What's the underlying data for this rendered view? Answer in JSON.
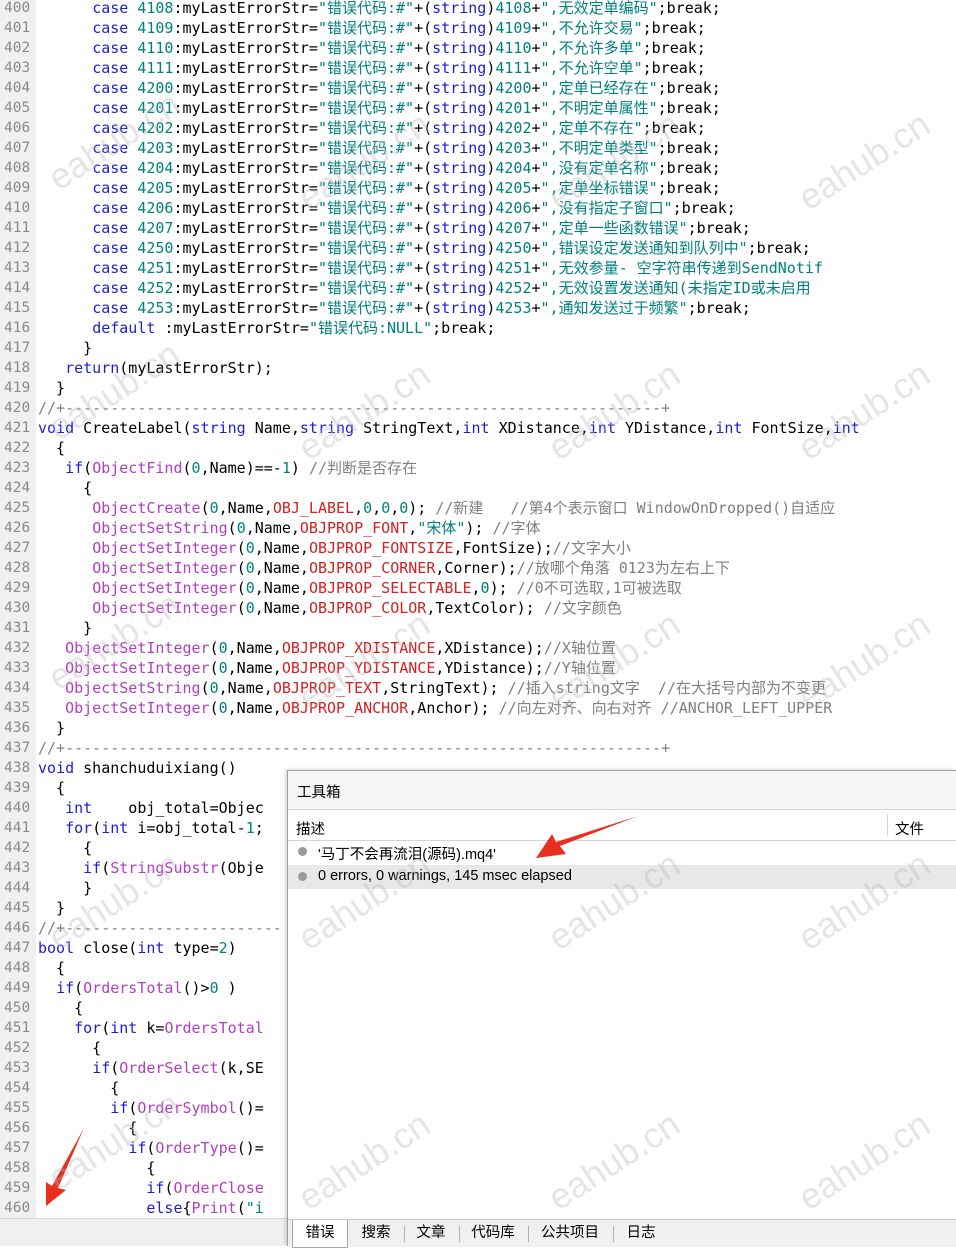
{
  "editor": {
    "lines": [
      {
        "n": "400",
        "t": "      case 4108:myLastErrorStr=\"错误代码:#\"+(string)4108+\",无效定单编码\";break;"
      },
      {
        "n": "401",
        "t": "      case 4109:myLastErrorStr=\"错误代码:#\"+(string)4109+\",不允许交易\";break;"
      },
      {
        "n": "402",
        "t": "      case 4110:myLastErrorStr=\"错误代码:#\"+(string)4110+\",不允许多单\";break;"
      },
      {
        "n": "403",
        "t": "      case 4111:myLastErrorStr=\"错误代码:#\"+(string)4111+\",不允许空单\";break;"
      },
      {
        "n": "404",
        "t": "      case 4200:myLastErrorStr=\"错误代码:#\"+(string)4200+\",定单已经存在\";break;"
      },
      {
        "n": "405",
        "t": "      case 4201:myLastErrorStr=\"错误代码:#\"+(string)4201+\",不明定单属性\";break;"
      },
      {
        "n": "406",
        "t": "      case 4202:myLastErrorStr=\"错误代码:#\"+(string)4202+\",定单不存在\";break;"
      },
      {
        "n": "407",
        "t": "      case 4203:myLastErrorStr=\"错误代码:#\"+(string)4203+\",不明定单类型\";break;"
      },
      {
        "n": "408",
        "t": "      case 4204:myLastErrorStr=\"错误代码:#\"+(string)4204+\",没有定单名称\";break;"
      },
      {
        "n": "409",
        "t": "      case 4205:myLastErrorStr=\"错误代码:#\"+(string)4205+\",定单坐标错误\";break;"
      },
      {
        "n": "410",
        "t": "      case 4206:myLastErrorStr=\"错误代码:#\"+(string)4206+\",没有指定子窗口\";break;"
      },
      {
        "n": "411",
        "t": "      case 4207:myLastErrorStr=\"错误代码:#\"+(string)4207+\",定单一些函数错误\";break;"
      },
      {
        "n": "412",
        "t": "      case 4250:myLastErrorStr=\"错误代码:#\"+(string)4250+\",错误设定发送通知到队列中\";break;"
      },
      {
        "n": "413",
        "t": "      case 4251:myLastErrorStr=\"错误代码:#\"+(string)4251+\",无效参量- 空字符串传递到SendNotif"
      },
      {
        "n": "414",
        "t": "      case 4252:myLastErrorStr=\"错误代码:#\"+(string)4252+\",无效设置发送通知(未指定ID或未启用"
      },
      {
        "n": "415",
        "t": "      case 4253:myLastErrorStr=\"错误代码:#\"+(string)4253+\",通知发送过于频繁\";break;"
      },
      {
        "n": "416",
        "t": "      default :myLastErrorStr=\"错误代码:NULL\";break;"
      },
      {
        "n": "417",
        "t": "     }"
      },
      {
        "n": "418",
        "t": "   return(myLastErrorStr);"
      },
      {
        "n": "419",
        "t": "  }"
      },
      {
        "n": "420",
        "t": "//+------------------------------------------------------------------+"
      },
      {
        "n": "421",
        "t": "void CreateLabel(string Name,string StringText,int XDistance,int YDistance,int FontSize,int"
      },
      {
        "n": "422",
        "t": "  {"
      },
      {
        "n": "423",
        "t": "   if(ObjectFind(0,Name)==-1) //判断是否存在"
      },
      {
        "n": "424",
        "t": "     {"
      },
      {
        "n": "425",
        "t": "      ObjectCreate(0,Name,OBJ_LABEL,0,0,0); //新建   //第4个表示窗口 WindowOnDropped()自适应"
      },
      {
        "n": "426",
        "t": "      ObjectSetString(0,Name,OBJPROP_FONT,\"宋体\"); //字体"
      },
      {
        "n": "427",
        "t": "      ObjectSetInteger(0,Name,OBJPROP_FONTSIZE,FontSize);//文字大小"
      },
      {
        "n": "428",
        "t": "      ObjectSetInteger(0,Name,OBJPROP_CORNER,Corner);//放哪个角落 0123为左右上下"
      },
      {
        "n": "429",
        "t": "      ObjectSetInteger(0,Name,OBJPROP_SELECTABLE,0); //0不可选取,1可被选取"
      },
      {
        "n": "430",
        "t": "      ObjectSetInteger(0,Name,OBJPROP_COLOR,TextColor); //文字颜色"
      },
      {
        "n": "431",
        "t": "     }"
      },
      {
        "n": "432",
        "t": "   ObjectSetInteger(0,Name,OBJPROP_XDISTANCE,XDistance);//X轴位置"
      },
      {
        "n": "433",
        "t": "   ObjectSetInteger(0,Name,OBJPROP_YDISTANCE,YDistance);//Y轴位置"
      },
      {
        "n": "434",
        "t": "   ObjectSetString(0,Name,OBJPROP_TEXT,StringText); //插入string文字  //在大括号内部为不变更"
      },
      {
        "n": "435",
        "t": "   ObjectSetInteger(0,Name,OBJPROP_ANCHOR,Anchor); //向左对齐、向右对齐 //ANCHOR_LEFT_UPPER"
      },
      {
        "n": "436",
        "t": "  }"
      },
      {
        "n": "437",
        "t": "//+------------------------------------------------------------------+"
      },
      {
        "n": "438",
        "t": "void shanchuduixiang()"
      },
      {
        "n": "439",
        "t": "  {"
      },
      {
        "n": "440",
        "t": "   int    obj_total=Objec"
      },
      {
        "n": "441",
        "t": "   for(int i=obj_total-1;"
      },
      {
        "n": "442",
        "t": "     {"
      },
      {
        "n": "443",
        "t": "     if(StringSubstr(Obje"
      },
      {
        "n": "444",
        "t": "     }"
      },
      {
        "n": "445",
        "t": "  }"
      },
      {
        "n": "446",
        "t": "//+------------------------"
      },
      {
        "n": "447",
        "t": "bool close(int type=2)"
      },
      {
        "n": "448",
        "t": "  {"
      },
      {
        "n": "449",
        "t": "  if(OrdersTotal()>0 )"
      },
      {
        "n": "450",
        "t": "    {"
      },
      {
        "n": "451",
        "t": "    for(int k=OrdersTotal"
      },
      {
        "n": "452",
        "t": "      {"
      },
      {
        "n": "453",
        "t": "      if(OrderSelect(k,SE"
      },
      {
        "n": "454",
        "t": "        {"
      },
      {
        "n": "455",
        "t": "        if(OrderSymbol()="
      },
      {
        "n": "456",
        "t": "          {"
      },
      {
        "n": "457",
        "t": "          if(OrderType()="
      },
      {
        "n": "458",
        "t": "            {"
      },
      {
        "n": "459",
        "t": "            if(OrderClose"
      },
      {
        "n": "460",
        "t": "            else{Print(\"i"
      }
    ]
  },
  "toolbox": {
    "title": "工具箱",
    "col_description": "描述",
    "col_file": "文件",
    "messages": [
      "'马丁不会再流泪(源码).mq4'",
      "0 errors, 0 warnings, 145 msec elapsed"
    ],
    "tabs": [
      "错误",
      "搜索",
      "文章",
      "代码库",
      "公共项目",
      "日志"
    ]
  },
  "watermark_text": "eahub.cn"
}
